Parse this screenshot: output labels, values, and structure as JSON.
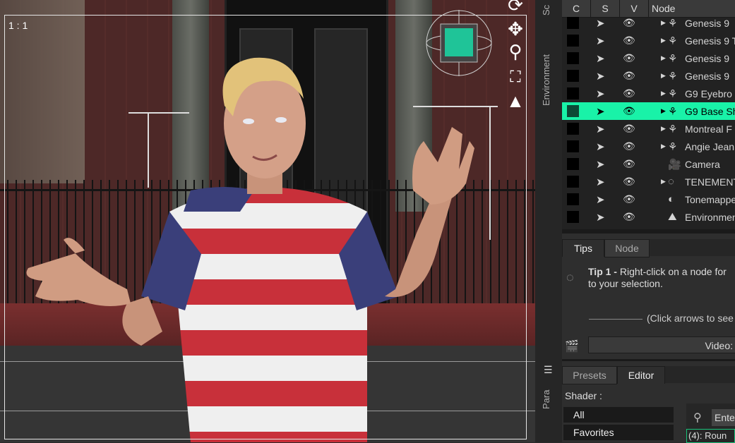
{
  "viewport": {
    "ratio_label": "1 : 1"
  },
  "scene_pane": {
    "columns": [
      "C",
      "S",
      "V",
      "Node"
    ],
    "rows": [
      {
        "label": "Genesis 9",
        "icon": "figure-icon",
        "arrow": true,
        "selected": false
      },
      {
        "label": "Genesis 9 T",
        "icon": "figure-icon",
        "arrow": true,
        "selected": false
      },
      {
        "label": "Genesis 9",
        "icon": "figure-icon",
        "arrow": true,
        "selected": false
      },
      {
        "label": "Genesis 9",
        "icon": "figure-icon",
        "arrow": true,
        "selected": false
      },
      {
        "label": "G9 Eyebro",
        "icon": "figure-icon",
        "arrow": true,
        "selected": false
      },
      {
        "label": "G9 Base Sh",
        "icon": "figure-icon",
        "arrow": true,
        "selected": true
      },
      {
        "label": "Montreal F",
        "icon": "figure-icon",
        "arrow": true,
        "selected": false
      },
      {
        "label": "Angie Jean",
        "icon": "figure-icon",
        "arrow": true,
        "selected": false
      },
      {
        "label": "Camera",
        "icon": "camera-icon",
        "arrow": false,
        "selected": false
      },
      {
        "label": "TENEMENT",
        "icon": "group-icon",
        "arrow": true,
        "selected": false
      },
      {
        "label": "Tonemapper",
        "icon": "tonemapper-icon",
        "arrow": false,
        "selected": false
      },
      {
        "label": "Environment",
        "icon": "environment-icon",
        "arrow": false,
        "selected": false
      }
    ]
  },
  "side_tabs": {
    "scene": "Sc",
    "environment": "Environment",
    "parameters": "Para"
  },
  "tips_pane": {
    "tabs": [
      "Tips",
      "Node"
    ],
    "tip_title": "Tip 1 -",
    "tip_body": "Right-click on a node for",
    "tip_body2": "to your selection.",
    "arrows_hint": "(Click arrows to see",
    "video_button": "Video:"
  },
  "editor_pane": {
    "tabs": [
      "Presets",
      "Editor"
    ],
    "shader_label": "Shader :",
    "list": [
      "All",
      "Favorites"
    ],
    "search_placeholder": "Ente",
    "result_item": "(4): Roun"
  },
  "colors": {
    "selection": "#19f2a8",
    "panel_bg": "#2e2e2e",
    "viewport_frame": "#e6e6e6"
  }
}
